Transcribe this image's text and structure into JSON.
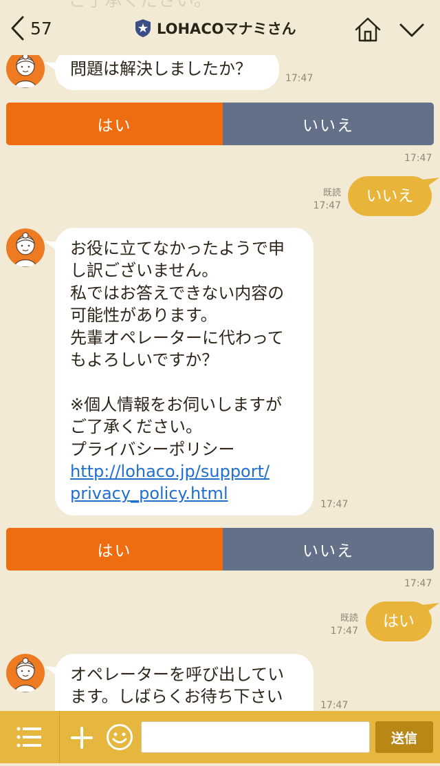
{
  "header": {
    "back_count": "57",
    "title": "LOHACOマナミさん",
    "ghost_text": "ご了承ください。"
  },
  "messages": {
    "m1": {
      "text": "問題は解決しましたか？",
      "time": "17:47"
    },
    "qr1": {
      "yes": "はい",
      "no": "いいえ",
      "time": "17:47"
    },
    "me1": {
      "text": "いいえ",
      "read": "既読",
      "time": "17:47"
    },
    "m2": {
      "lines": [
        "お役に立てなかったようで申",
        "し訳ございません。",
        "私ではお答えできない内容の",
        "可能性があります。",
        "先輩オペレーターに代わって",
        "もよろしいですか？",
        "",
        "※個人情報をお伺いしますが",
        "ご了承ください。",
        "プライバシーポリシー"
      ],
      "link_line1": "http://lohaco.jp/support/",
      "link_line2": "privacy_policy.html",
      "time": "17:47"
    },
    "qr2": {
      "yes": "はい",
      "no": "いいえ",
      "time": "17:47"
    },
    "me2": {
      "text": "はい",
      "read": "既読",
      "time": "17:47"
    },
    "m3": {
      "lines": [
        "オペレーターを呼び出してい",
        "ます。しばらくお待ち下さい"
      ],
      "time": "17:47"
    }
  },
  "footer": {
    "input_value": "",
    "send_label": "送信"
  },
  "colors": {
    "background": "#f3ead6",
    "yes_button": "#ee6d10",
    "no_button": "#627088",
    "my_bubble": "#e8b53a",
    "footer": "#e5b73f",
    "link": "#1f6fd0"
  },
  "icons": [
    "back-chevron-icon",
    "official-badge-icon",
    "home-icon",
    "chevron-down-icon",
    "menu-list-icon",
    "plus-icon",
    "emoji-icon",
    "avatar-operator-icon"
  ]
}
